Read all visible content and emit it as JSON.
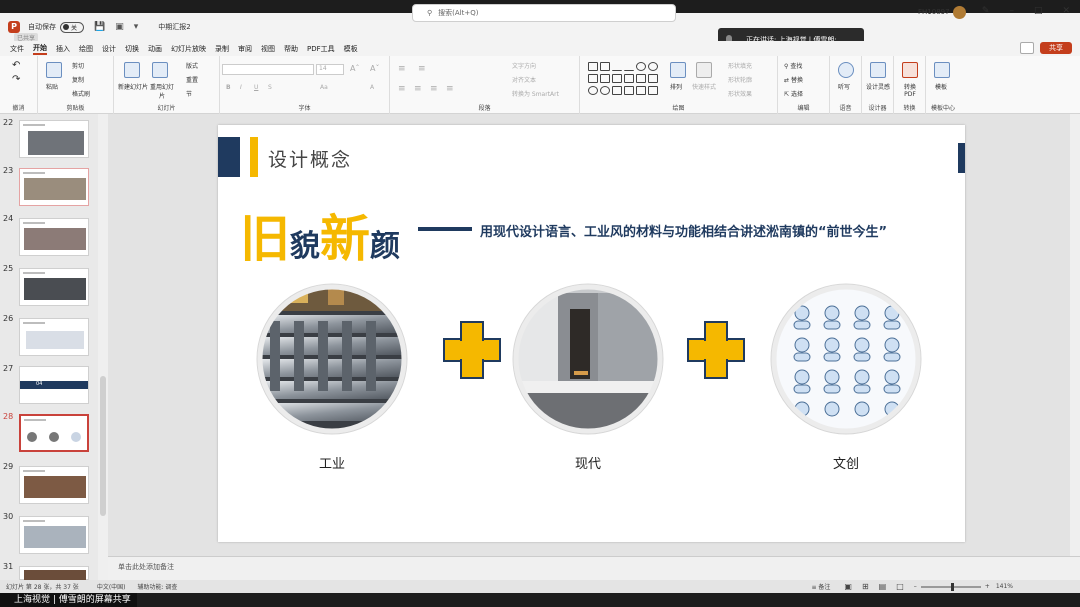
{
  "titlebar": {
    "logo": "P",
    "autosave_label": "自动保存",
    "autosave_state": "关",
    "subtitle": "已共享",
    "file_name": "中期汇报2",
    "search_placeholder": "搜索(Alt+Q)",
    "user": "FH10897"
  },
  "meeting": {
    "speaking": "正在讲话: 上海视觉 | 傅雪朗;",
    "share_label": "上海视觉 | 傅雪朗的屏幕共享"
  },
  "menu": {
    "items": [
      "文件",
      "开始",
      "插入",
      "绘图",
      "设计",
      "切换",
      "动画",
      "幻灯片放映",
      "录制",
      "审阅",
      "视图",
      "帮助",
      "PDF工具",
      "模板"
    ],
    "active": "开始",
    "share_button": "共享"
  },
  "ribbon": {
    "groups": {
      "undo": "撤消",
      "clipboard": "剪贴板",
      "slides": "幻灯片",
      "font": "字体",
      "paragraph": "段落",
      "drawing": "绘图",
      "editing": "编辑",
      "voice": "语音",
      "designer": "设计器",
      "convert": "转换",
      "template": "模板中心"
    },
    "paste": "粘贴",
    "cut": "剪切",
    "copy": "复制",
    "format_painter": "格式刷",
    "new_slide": "新建幻灯片",
    "reuse_slide": "重用幻灯片",
    "layout": "版式",
    "reset": "重置",
    "section": "节",
    "font_size": "14",
    "text_direction": "文字方向",
    "align_text": "对齐文本",
    "smartart": "转换为 SmartArt",
    "arrange": "排列",
    "quick_styles": "快速样式",
    "shape_fill": "形状填充",
    "shape_outline": "形状轮廓",
    "shape_effects": "形状效果",
    "find": "查找",
    "replace": "替换",
    "select": "选择",
    "dictate": "听写",
    "design_ideas": "设计灵感",
    "to_pdf": "转换 PDF",
    "template": "模板"
  },
  "thumbnails": [
    {
      "num": "22",
      "selected": false
    },
    {
      "num": "23",
      "selected": false
    },
    {
      "num": "24",
      "selected": false
    },
    {
      "num": "25",
      "selected": false
    },
    {
      "num": "26",
      "selected": false
    },
    {
      "num": "27",
      "selected": false,
      "label": "04"
    },
    {
      "num": "28",
      "selected": true
    },
    {
      "num": "29",
      "selected": false
    },
    {
      "num": "30",
      "selected": false
    },
    {
      "num": "31",
      "selected": false
    }
  ],
  "slide": {
    "section_title": "设计概念",
    "headline": [
      "旧",
      "貌",
      "新",
      "颜"
    ],
    "tagline": "用现代设计语言、工业风的材料与功能相结合讲述淞南镇的“前世今生”",
    "items": [
      {
        "label": "工业",
        "icon": "steel-beams-photo"
      },
      {
        "label": "现代",
        "icon": "modern-interior-photo"
      },
      {
        "label": "文创",
        "icon": "people-avatars-grid"
      }
    ],
    "accent": "#f5b800",
    "navy": "#1f3a5f"
  },
  "notes": {
    "placeholder": "单击此处添加备注"
  },
  "status": {
    "slide_info": "幻灯片 第 28 张，共 37 张",
    "language": "中文(中国)",
    "accessibility": "辅助功能: 调查",
    "notes_button": "备注",
    "zoom": "141%"
  }
}
